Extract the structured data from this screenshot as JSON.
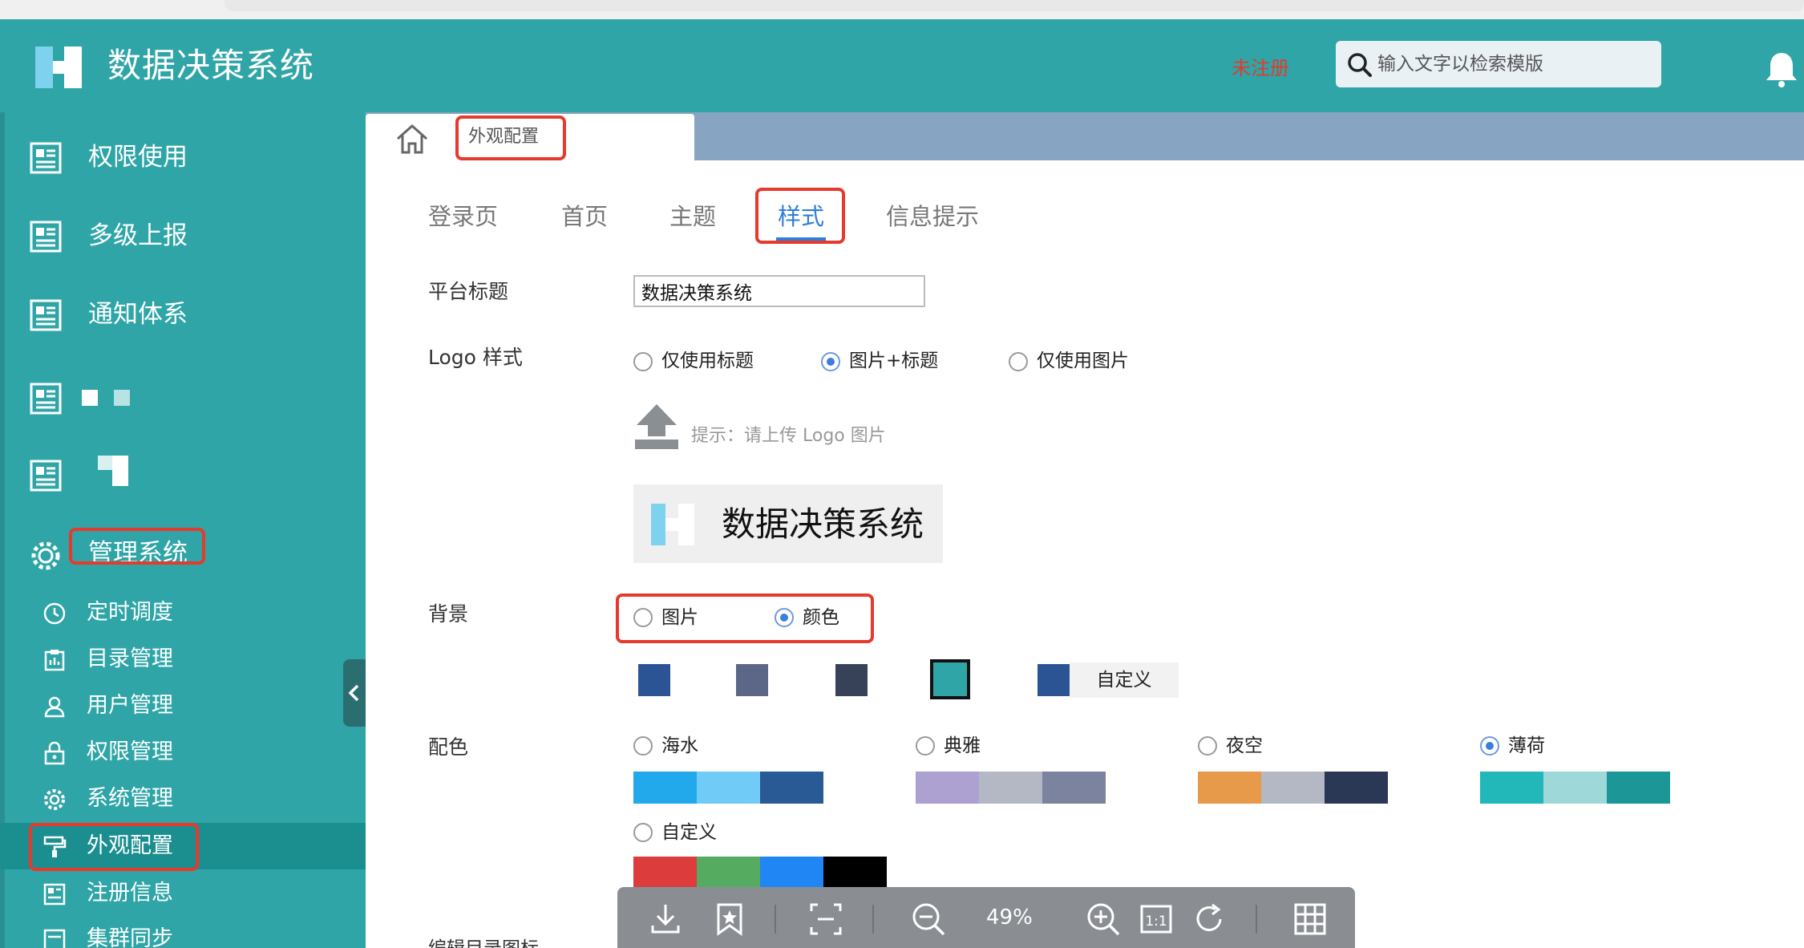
{
  "app": {
    "title": "数据决策系统",
    "unregistered": "未注册",
    "search_placeholder": "输入文字以检索模版"
  },
  "sidebar": {
    "items": [
      {
        "label": "权限使用"
      },
      {
        "label": "多级上报"
      },
      {
        "label": "通知体系"
      },
      {
        "label": ""
      },
      {
        "label": ""
      },
      {
        "label": "管理系统"
      }
    ],
    "subitems": [
      {
        "label": "定时调度"
      },
      {
        "label": "目录管理"
      },
      {
        "label": "用户管理"
      },
      {
        "label": "权限管理"
      },
      {
        "label": "系统管理"
      },
      {
        "label": "外观配置"
      },
      {
        "label": "注册信息"
      },
      {
        "label": "集群同步"
      }
    ]
  },
  "tabs": {
    "active_label": "外观配置"
  },
  "subtabs": [
    {
      "label": "登录页"
    },
    {
      "label": "首页"
    },
    {
      "label": "主题"
    },
    {
      "label": "样式"
    },
    {
      "label": "信息提示"
    }
  ],
  "form": {
    "platform_title_label": "平台标题",
    "platform_title_value": "数据决策系统",
    "logo_style_label": "Logo 样式",
    "logo_options": [
      "仅使用标题",
      "图片+标题",
      "仅使用图片"
    ],
    "upload_hint": "提示：请上传 Logo 图片",
    "logo_preview_text": "数据决策系统",
    "background_label": "背景",
    "background_options": [
      "图片",
      "颜色"
    ],
    "custom_label": "自定义",
    "color_scheme_label": "配色",
    "schemes": [
      {
        "name": "海水",
        "colors": [
          "#22a9ec",
          "#70ccf7",
          "#2a5a96",
          "#ffffff"
        ]
      },
      {
        "name": "典雅",
        "colors": [
          "#ada1d2",
          "#b3b8c4",
          "#7b839e",
          "#ffffff"
        ]
      },
      {
        "name": "夜空",
        "colors": [
          "#e89a4b",
          "#b3b8c4",
          "#2a3856",
          "#ffffff"
        ]
      },
      {
        "name": "薄荷",
        "colors": [
          "#22b7b8",
          "#9fd8d8",
          "#1d9698",
          "#ffffff"
        ]
      },
      {
        "name": "自定义",
        "colors": [
          "#dd3c3c",
          "#55ac60",
          "#1f86f4",
          "#000000"
        ]
      }
    ],
    "bg_swatches": [
      "#2a5493",
      "#5c6788",
      "#374258",
      "#2fa5a7",
      "#2a5493"
    ],
    "bottom_label": "编辑目录图标"
  },
  "viewer": {
    "zoom": "49%"
  },
  "colors": {
    "header": "#2fa5a7",
    "tabbar": "#87a4c2",
    "accent": "#2f7fd8",
    "highlight": "#e53a2c"
  }
}
